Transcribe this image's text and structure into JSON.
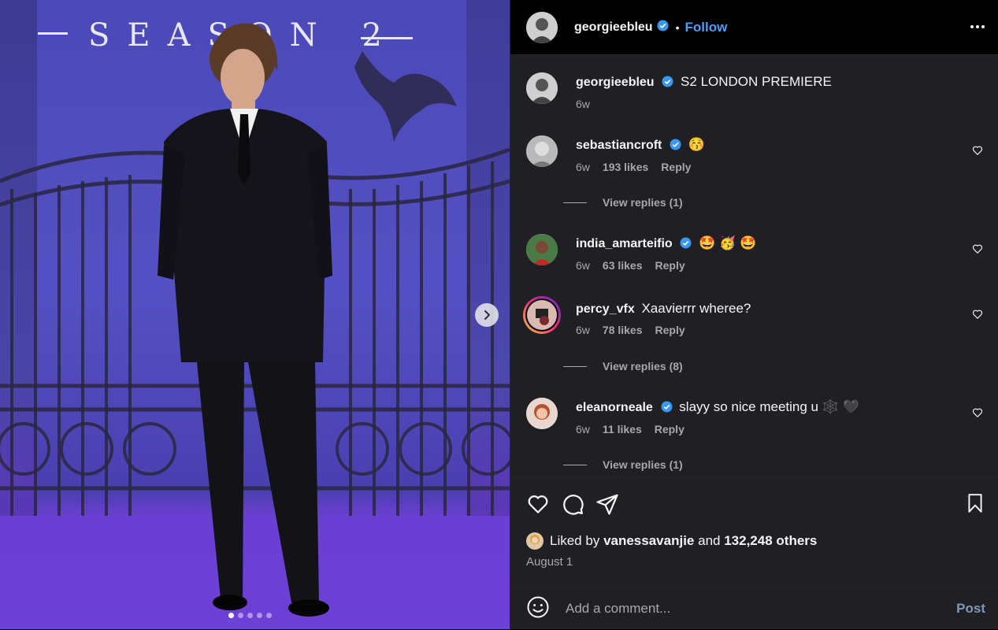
{
  "media": {
    "overlay_text": "SEASON 2",
    "slide_count": 5,
    "active_slide": 1
  },
  "header": {
    "username": "georgieebleu",
    "separator": "•",
    "follow_label": "Follow"
  },
  "caption": {
    "username": "georgieebleu",
    "text": "S2 LONDON PREMIERE",
    "time": "6w"
  },
  "comments": [
    {
      "username": "sebastiancroft",
      "text": "😚",
      "time": "6w",
      "likes": "193 likes",
      "reply": "Reply",
      "view_replies": "View replies (1)"
    },
    {
      "username": "india_amarteifio",
      "text": "🤩 🥳 🤩",
      "time": "6w",
      "likes": "63 likes",
      "reply": "Reply"
    },
    {
      "username": "percy_vfx",
      "text": "Xaavierrr wheree?",
      "time": "6w",
      "likes": "78 likes",
      "reply": "Reply",
      "view_replies": "View replies (8)"
    },
    {
      "username": "eleanorneale",
      "text": "slayy so nice meeting u 🕸️ 🖤",
      "time": "6w",
      "likes": "11 likes",
      "reply": "Reply",
      "view_replies": "View replies (1)"
    }
  ],
  "likes": {
    "prefix": "Liked by",
    "user": "vanessavanjie",
    "and": "and",
    "others": "132,248 others"
  },
  "date": "August 1",
  "add_comment": {
    "placeholder": "Add a comment...",
    "post_label": "Post"
  },
  "colors": {
    "accent": "#4a9df8",
    "verified": "#3897f0",
    "muted": "#a8a8a8",
    "panel_bg": "#202024"
  }
}
